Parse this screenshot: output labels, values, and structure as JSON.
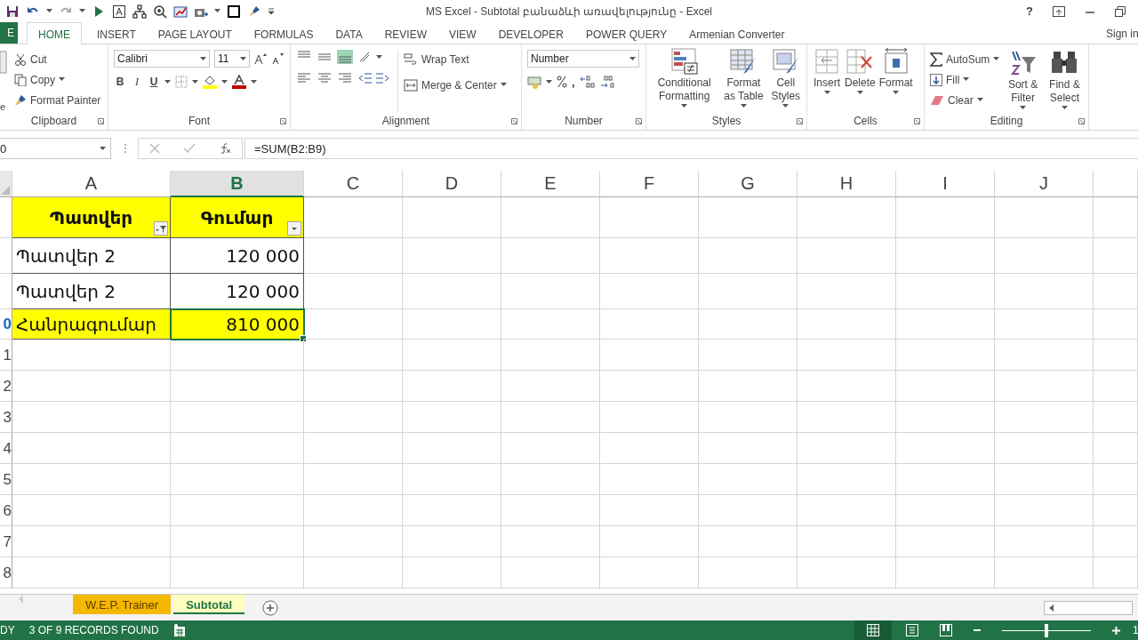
{
  "window": {
    "title": "MS Excel - Subtotal բանաձևի առավելությունը - Excel",
    "help": "?"
  },
  "tabs": [
    {
      "label": "E",
      "kind": "file",
      "selected": false
    },
    {
      "label": "HOME",
      "kind": "tab",
      "selected": true
    },
    {
      "label": "INSERT",
      "kind": "tab",
      "selected": false
    },
    {
      "label": "PAGE LAYOUT",
      "kind": "tab",
      "selected": false
    },
    {
      "label": "FORMULAS",
      "kind": "tab",
      "selected": false
    },
    {
      "label": "DATA",
      "kind": "tab",
      "selected": false
    },
    {
      "label": "REVIEW",
      "kind": "tab",
      "selected": false
    },
    {
      "label": "VIEW",
      "kind": "tab",
      "selected": false
    },
    {
      "label": "DEVELOPER",
      "kind": "tab",
      "selected": false
    },
    {
      "label": "POWER QUERY",
      "kind": "tab",
      "selected": false
    },
    {
      "label": "Armenian Converter",
      "kind": "tab",
      "selected": false
    }
  ],
  "sign_in": "Sign in",
  "ribbon": {
    "clipboard": {
      "label": "Clipboard",
      "paste": "e",
      "cut": "Cut",
      "copy": "Copy",
      "format_painter": "Format Painter"
    },
    "font": {
      "label": "Font",
      "font_name": "Calibri",
      "font_size": "11",
      "bold": "B",
      "italic": "I",
      "underline": "U"
    },
    "alignment": {
      "label": "Alignment",
      "wrap_text": "Wrap Text",
      "merge": "Merge & Center"
    },
    "number": {
      "label": "Number",
      "format": "Number",
      "comma": ","
    },
    "styles": {
      "label": "Styles",
      "buttons": [
        "Conditional Formatting",
        "Format as Table",
        "Cell Styles"
      ]
    },
    "cells": {
      "label": "Cells",
      "buttons": [
        "Insert",
        "Delete",
        "Format"
      ]
    },
    "editing": {
      "label": "Editing",
      "autosum": "AutoSum",
      "fill": "Fill",
      "clear": "Clear",
      "sort": "Sort & Filter",
      "find": "Find & Select"
    }
  },
  "formula_bar": {
    "name_box": "0",
    "formula": "=SUM(B2:B9)"
  },
  "columns": [
    {
      "label": "A",
      "selected": false
    },
    {
      "label": "B",
      "selected": true
    },
    {
      "label": "C",
      "selected": false
    },
    {
      "label": "D",
      "selected": false
    },
    {
      "label": "E",
      "selected": false
    },
    {
      "label": "F",
      "selected": false
    },
    {
      "label": "G",
      "selected": false
    },
    {
      "label": "H",
      "selected": false
    },
    {
      "label": "I",
      "selected": false
    },
    {
      "label": "J",
      "selected": false
    }
  ],
  "rows": [
    {
      "kind": "header",
      "cells": [
        {
          "text": "Պատվեր",
          "filtered": true,
          "selected": false
        },
        {
          "text": "Գումար",
          "filtered": false,
          "selected": false
        }
      ]
    },
    {
      "kind": "data",
      "cells": [
        {
          "text": "Պատվեր 2",
          "selected": false
        },
        {
          "text": "120 000",
          "selected": false
        }
      ]
    },
    {
      "kind": "data",
      "cells": [
        {
          "text": "Պատվեր 2",
          "selected": false
        },
        {
          "text": "120 000",
          "selected": false
        }
      ]
    },
    {
      "kind": "total",
      "number": "0",
      "cells": [
        {
          "text": "Հանրագումար",
          "selected": false
        },
        {
          "text": "810 000",
          "selected": true
        }
      ]
    },
    {
      "kind": "empty",
      "number": "1"
    },
    {
      "kind": "empty",
      "number": "2"
    },
    {
      "kind": "empty",
      "number": "3"
    },
    {
      "kind": "empty",
      "number": "4"
    },
    {
      "kind": "empty",
      "number": "5"
    },
    {
      "kind": "empty",
      "number": "6"
    },
    {
      "kind": "empty",
      "number": "7"
    },
    {
      "kind": "empty",
      "number": "8"
    }
  ],
  "sheets": [
    {
      "label": "W.E.P. Trainer",
      "selected": false,
      "color": "#f5b800"
    },
    {
      "label": "Subtotal",
      "selected": true,
      "color": "#ffffc0"
    }
  ],
  "status_bar": {
    "mode": "DY",
    "records": "3 OF 9 RECORDS FOUND",
    "zoom_slider": {
      "level": 0.5
    },
    "zoom_percent": "1"
  }
}
